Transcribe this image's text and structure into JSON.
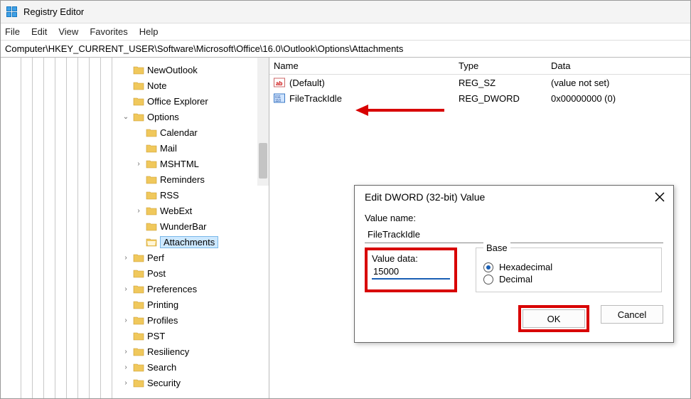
{
  "window": {
    "title": "Registry Editor"
  },
  "menu": {
    "file": "File",
    "edit": "Edit",
    "view": "View",
    "favorites": "Favorites",
    "help": "Help"
  },
  "address": "Computer\\HKEY_CURRENT_USER\\Software\\Microsoft\\Office\\16.0\\Outlook\\Options\\Attachments",
  "tree": {
    "n0": "NewOutlook",
    "n1": "Note",
    "n2": "Office Explorer",
    "n3": "Options",
    "s0": "Calendar",
    "s1": "Mail",
    "s2": "MSHTML",
    "s3": "Reminders",
    "s4": "RSS",
    "s5": "WebExt",
    "s6": "WunderBar",
    "s7": "Attachments",
    "n4": "Perf",
    "n5": "Post",
    "n6": "Preferences",
    "n7": "Printing",
    "n8": "Profiles",
    "n9": "PST",
    "n10": "Resiliency",
    "n11": "Search",
    "n12": "Security"
  },
  "list": {
    "headers": {
      "name": "Name",
      "type": "Type",
      "data": "Data"
    },
    "r0": {
      "name": "(Default)",
      "type": "REG_SZ",
      "data": "(value not set)"
    },
    "r1": {
      "name": "FileTrackIdle",
      "type": "REG_DWORD",
      "data": "0x00000000 (0)"
    }
  },
  "dialog": {
    "title": "Edit DWORD (32-bit) Value",
    "value_name_label": "Value name:",
    "value_name": "FileTrackIdle",
    "value_data_label": "Value data:",
    "value_data": "15000",
    "base_label": "Base",
    "hex_label": "Hexadecimal",
    "dec_label": "Decimal",
    "ok": "OK",
    "cancel": "Cancel"
  }
}
